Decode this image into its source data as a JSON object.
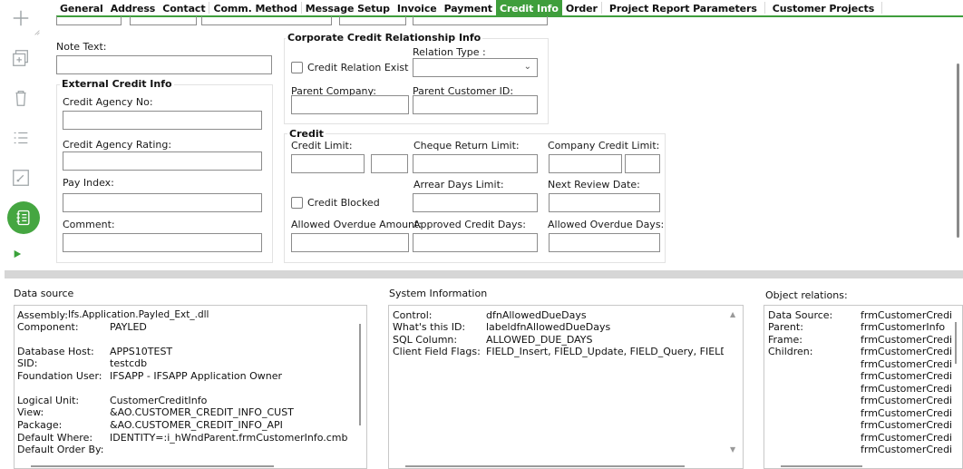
{
  "toolbar": {
    "add_icon": "plus-icon",
    "duplicate_icon": "duplicate-icon",
    "delete_icon": "trash-icon",
    "list_icon": "list-icon",
    "open_icon": "open-arrow-icon",
    "details_icon": "details-icon",
    "play_icon": "play-icon",
    "active_color": "#45a641"
  },
  "tabs": [
    {
      "label": "General"
    },
    {
      "label": "Address"
    },
    {
      "label": "Contact"
    },
    {
      "label": "Comm. Method"
    },
    {
      "label": "Message Setup"
    },
    {
      "label": "Invoice"
    },
    {
      "label": "Payment"
    },
    {
      "label": "Credit Info"
    },
    {
      "label": "Order"
    },
    {
      "label": "Project Report Parameters"
    },
    {
      "label": "Customer Projects"
    }
  ],
  "active_tab": "Credit Info",
  "form": {
    "note_text_label": "Note Text:",
    "note_text_value": "",
    "external": {
      "title": "External Credit Info",
      "agency_no_label": "Credit Agency No:",
      "agency_no_value": "",
      "agency_rating_label": "Credit Agency Rating:",
      "agency_rating_value": "",
      "pay_index_label": "Pay Index:",
      "pay_index_value": "",
      "comment_label": "Comment:",
      "comment_value": ""
    },
    "corporate": {
      "title": "Corporate Credit Relationship Info",
      "relation_exist_label": "Credit Relation Exist",
      "relation_exist_checked": false,
      "relation_type_label": "Relation Type :",
      "relation_type_value": "",
      "parent_company_label": "Parent Company:",
      "parent_company_value": "",
      "parent_customer_label": "Parent Customer ID:",
      "parent_customer_value": ""
    },
    "credit": {
      "title": "Credit",
      "credit_limit_label": "Credit Limit:",
      "credit_limit_value": "",
      "credit_limit_currency": "",
      "cheque_return_label": "Cheque Return Limit:",
      "cheque_return_value": "",
      "company_credit_label": "Company Credit Limit:",
      "company_credit_value": "",
      "company_credit_currency": "",
      "credit_blocked_label": "Credit Blocked",
      "credit_blocked_checked": false,
      "arrear_days_label": "Arrear Days Limit:",
      "arrear_days_value": "",
      "next_review_label": "Next Review Date:",
      "next_review_value": "",
      "allowed_overdue_amount_label": "Allowed Overdue Amount:",
      "allowed_overdue_amount_value": "",
      "approved_credit_days_label": "Approved Credit Days:",
      "approved_credit_days_value": "",
      "allowed_overdue_days_label": "Allowed Overdue Days:",
      "allowed_overdue_days_value": ""
    }
  },
  "data_source": {
    "title": "Data source",
    "rows": [
      {
        "key": "Assembly:",
        "value": "Ifs.Application.Payled_Ext_.dll"
      },
      {
        "key": "Component:",
        "value": "PAYLED"
      },
      {
        "key": "",
        "value": ""
      },
      {
        "key": "Database Host:",
        "value": "APPS10TEST"
      },
      {
        "key": "SID:",
        "value": "testcdb"
      },
      {
        "key": "Foundation User:",
        "value": "IFSAPP - IFSAPP Application Owner"
      },
      {
        "key": "",
        "value": ""
      },
      {
        "key": "Logical Unit:",
        "value": "CustomerCreditInfo"
      },
      {
        "key": "View:",
        "value": "&AO.CUSTOMER_CREDIT_INFO_CUST"
      },
      {
        "key": "Package:",
        "value": "&AO.CUSTOMER_CREDIT_INFO_API"
      },
      {
        "key": "Default Where:",
        "value": "IDENTITY=:i_hWndParent.frmCustomerInfo.cmbCust"
      },
      {
        "key": "Default Order By:",
        "value": ""
      }
    ]
  },
  "system_info": {
    "title": "System Information",
    "rows": [
      {
        "key": "Control:",
        "value": "dfnAllowedDueDays"
      },
      {
        "key": "What's this ID:",
        "value": "labeldfnAllowedDueDays"
      },
      {
        "key": "SQL Column:",
        "value": "ALLOWED_DUE_DAYS"
      },
      {
        "key": "Client Field Flags:",
        "value": "FIELD_Insert, FIELD_Update, FIELD_Query, FIELD_A"
      }
    ]
  },
  "object_relations": {
    "title": "Object relations:",
    "rows": [
      {
        "key": "Data Source:",
        "value": "frmCustomerCredi"
      },
      {
        "key": "Parent:",
        "value": "frmCustomerInfo"
      },
      {
        "key": "Frame:",
        "value": "frmCustomerCredi"
      },
      {
        "key": "Children:",
        "value": "frmCustomerCredi"
      },
      {
        "key": "",
        "value": "frmCustomerCredi"
      },
      {
        "key": "",
        "value": "frmCustomerCredi"
      },
      {
        "key": "",
        "value": "frmCustomerCredi"
      },
      {
        "key": "",
        "value": "frmCustomerCredi"
      },
      {
        "key": "",
        "value": "frmCustomerCredi"
      },
      {
        "key": "",
        "value": "frmCustomerCredi"
      },
      {
        "key": "",
        "value": "frmCustomerCredi"
      },
      {
        "key": "",
        "value": "frmCustomerCredi"
      }
    ]
  }
}
